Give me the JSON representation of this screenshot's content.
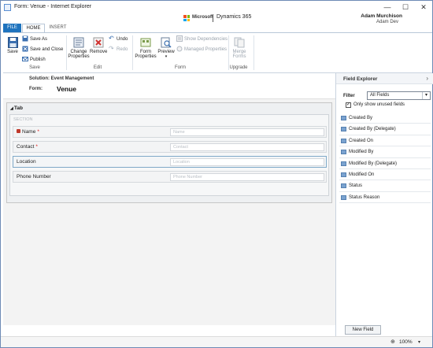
{
  "window": {
    "title": "Form: Venue - Internet Explorer",
    "minimize_glyph": "—",
    "maximize_glyph": "☐",
    "close_glyph": "✕"
  },
  "brand": {
    "microsoft": "Microsoft",
    "product": "Dynamics 365",
    "user_name": "Adam Murchison",
    "user_org": "Adam Dev"
  },
  "ribbon_tabs": [
    "FILE",
    "HOME",
    "INSERT"
  ],
  "ribbon": {
    "save": "Save",
    "save_as": "Save As",
    "save_and_close": "Save and Close",
    "publish": "Publish",
    "group_save": "Save",
    "change_properties_1": "Change",
    "change_properties_2": "Properties",
    "remove": "Remove",
    "undo": "Undo",
    "redo": "Redo",
    "group_edit": "Edit",
    "form_properties_1": "Form",
    "form_properties_2": "Properties",
    "preview": "Preview",
    "show_dependencies": "Show Dependencies",
    "managed_properties": "Managed Properties",
    "group_form": "Form",
    "merge_forms_1": "Merge",
    "merge_forms_2": "Forms",
    "group_upgrade": "Upgrade"
  },
  "form_header": {
    "solution": "Solution: Event Management",
    "form_label": "Form:",
    "form_name": "Venue"
  },
  "canvas": {
    "tab_title": "Tab",
    "section_label": "SECTION",
    "fields": [
      {
        "label": "Name",
        "placeholder": "Name",
        "required": "*"
      },
      {
        "label": "Contact",
        "placeholder": "Contact",
        "required": "*"
      },
      {
        "label": "Location",
        "placeholder": "Location",
        "required": ""
      },
      {
        "label": "Phone Number",
        "placeholder": "Phone Number",
        "required": ""
      }
    ]
  },
  "explorer": {
    "title": "Field Explorer",
    "filter_label": "Filter",
    "filter_value": "All Fields",
    "only_unused": "Only show unused fields",
    "fields": [
      "Created By",
      "Created By (Delegate)",
      "Created On",
      "Modified By",
      "Modified By (Delegate)",
      "Modified On",
      "Status",
      "Status Reason"
    ],
    "new_field": "New Field"
  },
  "status": {
    "zoom": "100%"
  },
  "colors": {
    "accent": "#1e73be",
    "required": "#dd1111"
  }
}
